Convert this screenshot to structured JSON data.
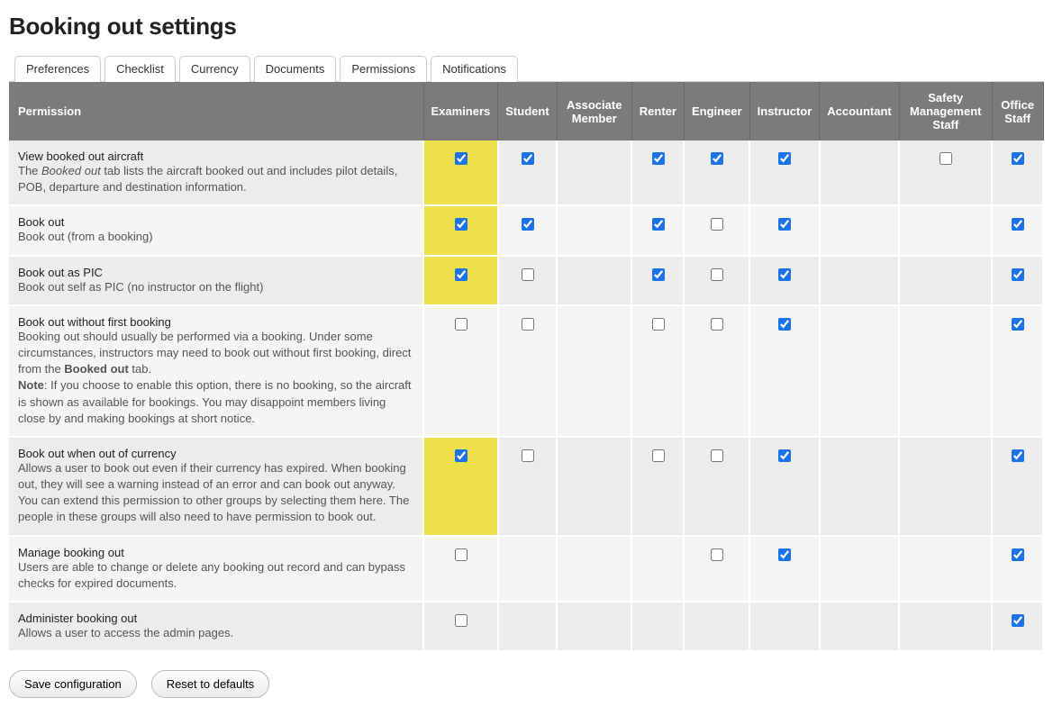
{
  "page_title": "Booking out settings",
  "tabs": [
    {
      "label": "Preferences",
      "active": false
    },
    {
      "label": "Checklist",
      "active": false
    },
    {
      "label": "Currency",
      "active": false
    },
    {
      "label": "Documents",
      "active": false
    },
    {
      "label": "Permissions",
      "active": true
    },
    {
      "label": "Notifications",
      "active": false
    }
  ],
  "columns": [
    "Permission",
    "Examiners",
    "Student",
    "Associate Member",
    "Renter",
    "Engineer",
    "Instructor",
    "Accountant",
    "Safety Management Staff",
    "Office Staff"
  ],
  "rows": [
    {
      "title": "View booked out aircraft",
      "desc_html": "The <em>Booked out</em> tab lists the aircraft booked out and includes pilot details, POB, departure and destination information.",
      "cells": [
        {
          "checked": true,
          "highlight": true
        },
        {
          "checked": true
        },
        {
          "empty": true
        },
        {
          "checked": true
        },
        {
          "checked": true
        },
        {
          "checked": true
        },
        {
          "empty": true
        },
        {
          "checked": false
        },
        {
          "checked": true
        }
      ]
    },
    {
      "title": "Book out",
      "desc_html": "Book out (from a booking)",
      "cells": [
        {
          "checked": true,
          "highlight": true
        },
        {
          "checked": true
        },
        {
          "empty": true
        },
        {
          "checked": true
        },
        {
          "checked": false
        },
        {
          "checked": true
        },
        {
          "empty": true
        },
        {
          "empty": true
        },
        {
          "checked": true
        }
      ]
    },
    {
      "title": "Book out as PIC",
      "desc_html": "Book out self as PIC (no instructor on the flight)",
      "cells": [
        {
          "checked": true,
          "highlight": true
        },
        {
          "checked": false
        },
        {
          "empty": true
        },
        {
          "checked": true
        },
        {
          "checked": false
        },
        {
          "checked": true
        },
        {
          "empty": true
        },
        {
          "empty": true
        },
        {
          "checked": true
        }
      ]
    },
    {
      "title": "Book out without first booking",
      "desc_html": "Booking out should usually be performed via a booking. Under some circumstances, instructors may need to book out without first booking, direct from the <strong>Booked out</strong> tab.<br><strong>Note</strong>: If you choose to enable this option, there is no booking, so the aircraft is shown as available for bookings. You may disappoint members living close by and making bookings at short notice.",
      "cells": [
        {
          "checked": false
        },
        {
          "checked": false
        },
        {
          "empty": true
        },
        {
          "checked": false
        },
        {
          "checked": false
        },
        {
          "checked": true
        },
        {
          "empty": true
        },
        {
          "empty": true
        },
        {
          "checked": true
        }
      ]
    },
    {
      "title": "Book out when out of currency",
      "desc_html": "Allows a user to book out even if their currency has expired. When booking out, they will see a warning instead of an error and can book out anyway. You can extend this permission to other groups by selecting them here. The people in these groups will also need to have permission to book out.",
      "cells": [
        {
          "checked": true,
          "highlight": true
        },
        {
          "checked": false
        },
        {
          "empty": true
        },
        {
          "checked": false
        },
        {
          "checked": false
        },
        {
          "checked": true
        },
        {
          "empty": true
        },
        {
          "empty": true
        },
        {
          "checked": true
        }
      ]
    },
    {
      "title": "Manage booking out",
      "desc_html": "Users are able to change or delete any booking out record and can bypass checks for expired documents.",
      "cells": [
        {
          "checked": false
        },
        {
          "empty": true
        },
        {
          "empty": true
        },
        {
          "empty": true
        },
        {
          "checked": false
        },
        {
          "checked": true
        },
        {
          "empty": true
        },
        {
          "empty": true
        },
        {
          "checked": true
        }
      ]
    },
    {
      "title": "Administer booking out",
      "desc_html": "Allows a user to access the admin pages.",
      "cells": [
        {
          "checked": false
        },
        {
          "empty": true
        },
        {
          "empty": true
        },
        {
          "empty": true
        },
        {
          "empty": true
        },
        {
          "empty": true
        },
        {
          "empty": true
        },
        {
          "empty": true
        },
        {
          "checked": true
        }
      ]
    }
  ],
  "buttons": {
    "save": "Save configuration",
    "reset": "Reset to defaults"
  }
}
